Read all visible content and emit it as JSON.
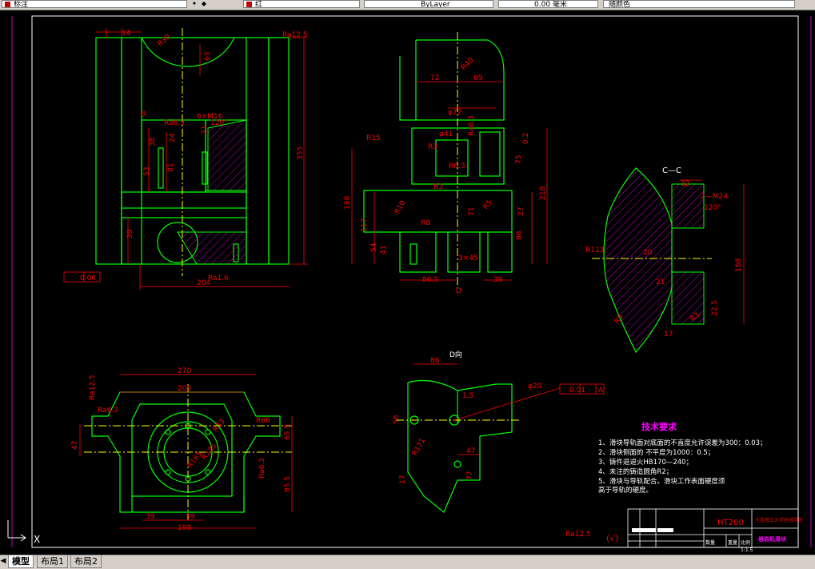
{
  "toolbar": {
    "layer_value": "标注",
    "color_value": "红",
    "linetype_value": "ByLayer",
    "lineweight_value": "0.00 毫米",
    "plotstyle_value": "随颜色"
  },
  "tabs": [
    {
      "label": "模型",
      "active": true
    },
    {
      "label": "布局1",
      "active": false
    },
    {
      "label": "布局2",
      "active": false
    }
  ],
  "drawing": {
    "section_cc": "C—C",
    "view_d_arrow": "D",
    "view_d_title": "D向",
    "tech_title": "技术要求",
    "tech_items": [
      "1、滑块导轨面对底面的不直度允许误差为300：0.03；",
      "2、滑块侧面的  不平度为1000：0.5；",
      "3、铸件退退火HB170—240；",
      "4、未注的铸造圆角R2；",
      "5、滑块与导轨配合。滑块工作表面硬度须",
      "    高于导轨的硬度。"
    ],
    "material": "HT200",
    "school": "大连理工大学机械学院",
    "part_name": "凿岩机滑块",
    "scale_label": "比例",
    "scale_value": "1:1.5",
    "qty_label": "数量",
    "weight_label": "重量",
    "roughness_rest": "Ra12.5",
    "dims": {
      "front": [
        "14",
        "R30",
        "Ra12.5",
        "63",
        "6×M16",
        "120°",
        "355",
        "8",
        "Ra6.3",
        "38",
        "24",
        "53",
        "81",
        "39",
        "204",
        "Ra1.6",
        "0.06",
        "21"
      ],
      "side": [
        "72",
        "69",
        "R40",
        "R15",
        "φ72",
        "R3",
        "φ41",
        "R6.3",
        "75",
        "Ra6.3",
        "218",
        "188",
        "117",
        "R10",
        "54",
        "41",
        "R3",
        "R8",
        "71",
        "88",
        "3×45",
        "39",
        "86.5",
        "27",
        "R5",
        "0.2"
      ],
      "section": [
        "32",
        "2—M24",
        "120°",
        "R113",
        "20",
        "188",
        "21",
        "22.5",
        "17",
        "R5",
        "R3"
      ],
      "top": [
        "270",
        "205",
        "Ra12.5",
        "Ra6.3",
        "R33",
        "R165",
        "R66",
        "65.5",
        "85.5",
        "Ra6.3",
        "47",
        "39",
        "39",
        "198",
        "R135"
      ],
      "dview": [
        "86",
        "1.5",
        "φ20",
        "0.01",
        "A",
        "R171",
        "47",
        "56",
        "77",
        "17"
      ]
    }
  }
}
